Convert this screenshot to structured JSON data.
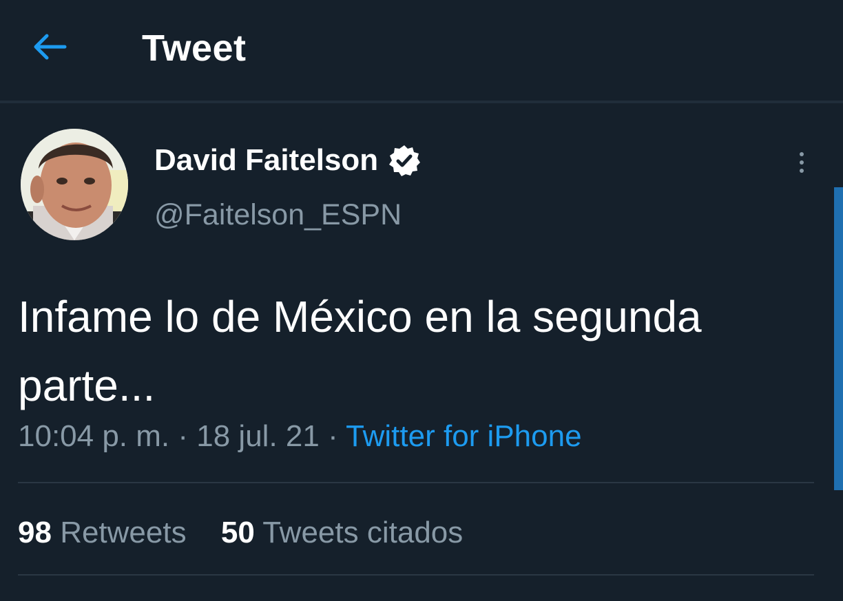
{
  "header": {
    "title": "Tweet",
    "back_icon": "arrow-left-icon",
    "accent": "#1d9bf0"
  },
  "tweet": {
    "author": {
      "display_name": "David Faitelson",
      "handle": "@Faitelson_ESPN",
      "verified": true
    },
    "text": "Infame lo de México en la segunda parte...",
    "time": "10:04 p. m.",
    "separator": "·",
    "date": "18 jul. 21",
    "source": "Twitter for iPhone",
    "stats": {
      "retweets_count": "98",
      "retweets_label": "Retweets",
      "quotes_count": "50",
      "quotes_label": "Tweets citados"
    }
  },
  "colors": {
    "background": "#15202b",
    "secondary_text": "#8899a6",
    "link": "#1d9bf0"
  }
}
